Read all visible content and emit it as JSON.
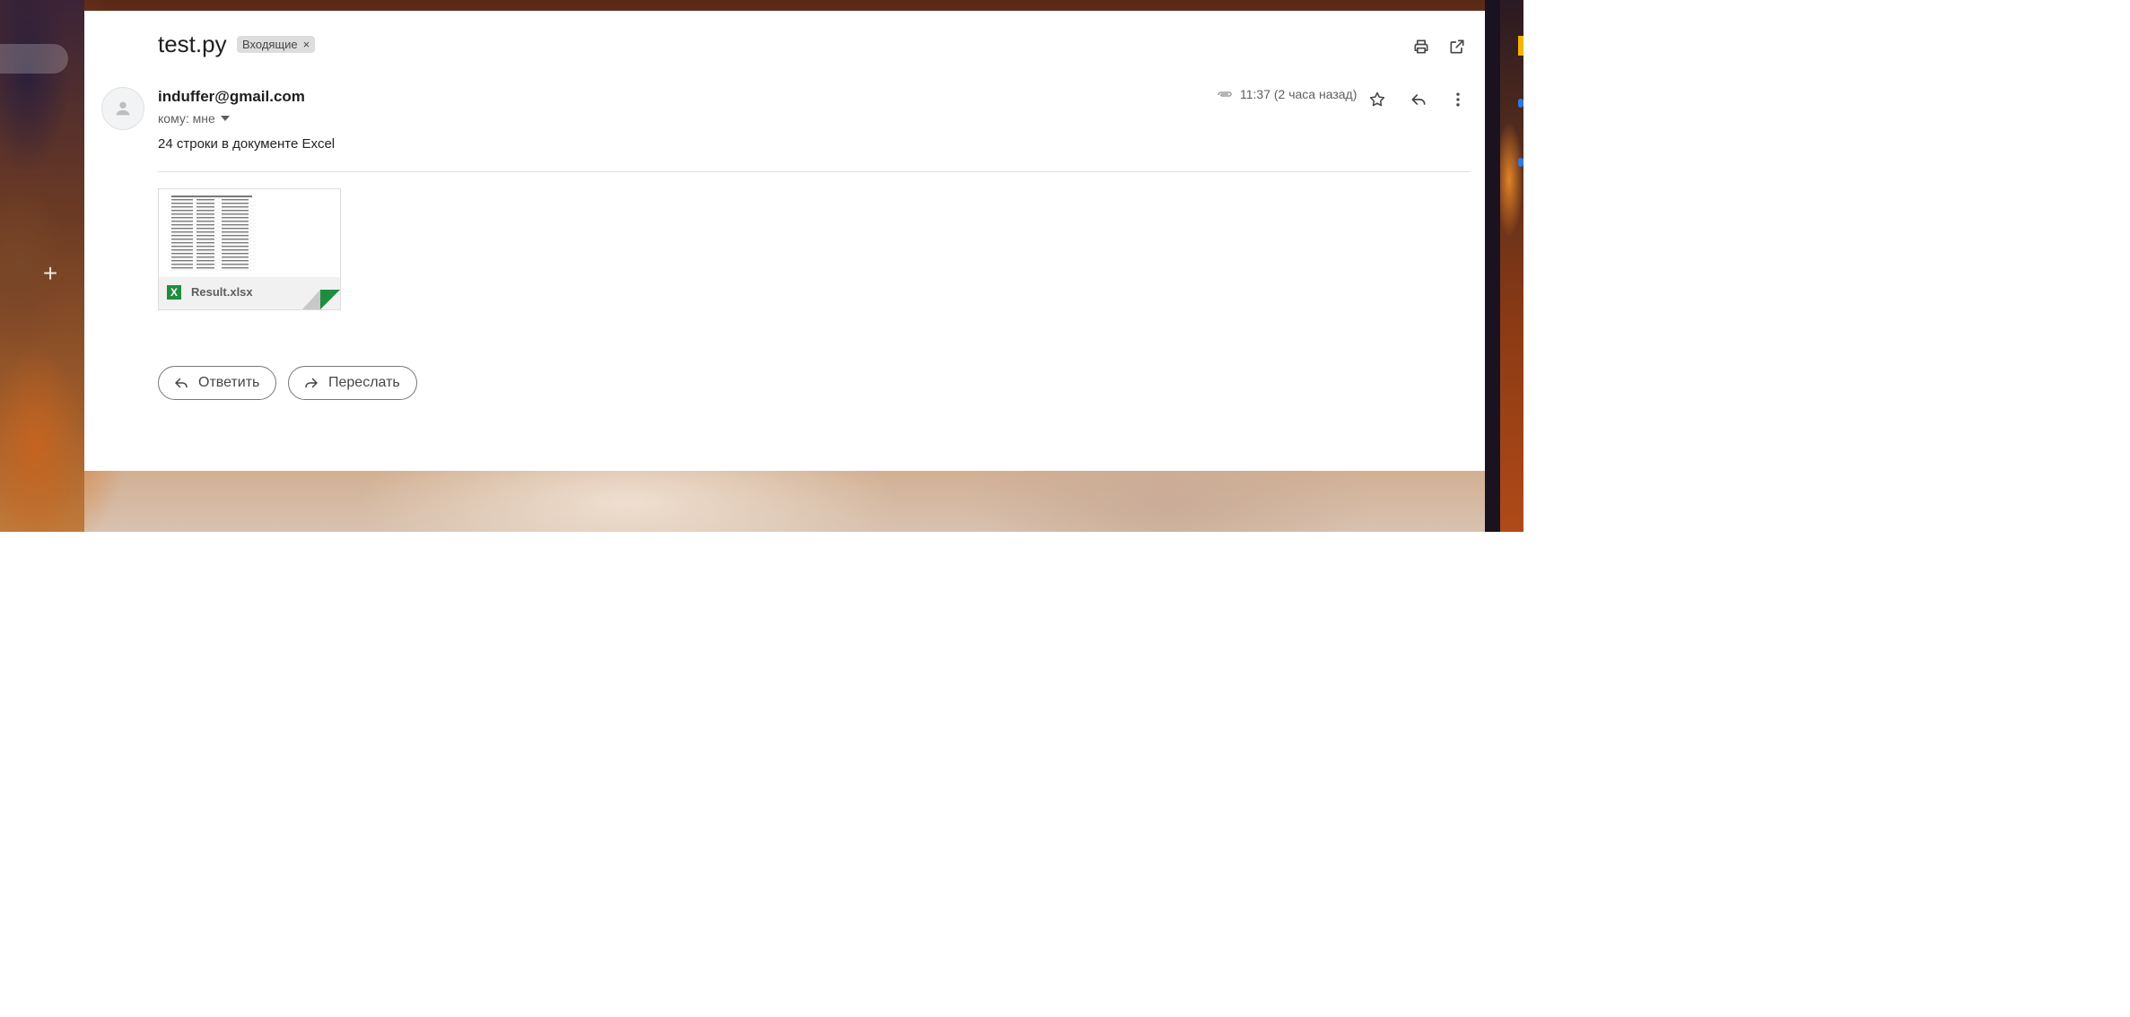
{
  "email": {
    "subject": "test.py",
    "label": "Входящие",
    "label_remove": "×",
    "sender": "induffer@gmail.com",
    "to_line": "кому: мне",
    "time": "11:37 (2 часа назад)",
    "body": "24 строки в документе Excel"
  },
  "attachment": {
    "file_name": "Result.xlsx",
    "file_icon": "X"
  },
  "actions": {
    "reply_label": "Ответить",
    "forward_label": "Переслать"
  },
  "sidebar": {
    "compose_plus": "+"
  },
  "colors": {
    "excel_green": "#1e8e3e",
    "label_chip": "#dddddd",
    "text_primary": "#1f1f1f",
    "text_secondary": "#5e5e5e"
  },
  "icons": [
    "print-icon",
    "open-new-window-icon",
    "attachment-clip-icon",
    "star-icon",
    "reply-icon",
    "more-vert-icon",
    "avatar-icon",
    "chevron-down-icon",
    "forward-icon",
    "plus-icon",
    "excel-icon"
  ]
}
